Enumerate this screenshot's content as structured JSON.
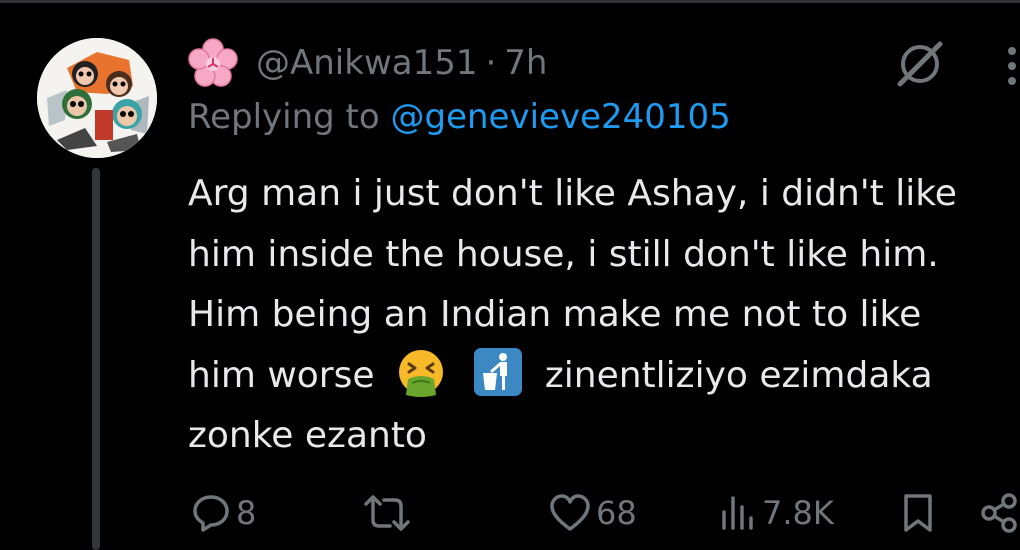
{
  "post": {
    "handle": "@Anikwa151",
    "separator": "·",
    "time": "7h",
    "replying_prefix": "Replying to",
    "replying_handle": "@genevieve240105",
    "text_lines": [
      "Arg man i just don't like Ashay, i didn't like",
      "him inside the house, i still don't like him.",
      "Him being an Indian make me not to like",
      "him worse",
      "zinentliziyo ezimdaka",
      "zonke ezanto"
    ],
    "emojis": [
      "vomiting-face",
      "litter-in-bin-sign"
    ]
  },
  "actions": {
    "replies": "8",
    "likes": "68",
    "views": "7.8K"
  },
  "colors": {
    "background": "#000000",
    "text": "#e7e9ea",
    "muted": "#71767b",
    "link": "#1d9bf0"
  }
}
